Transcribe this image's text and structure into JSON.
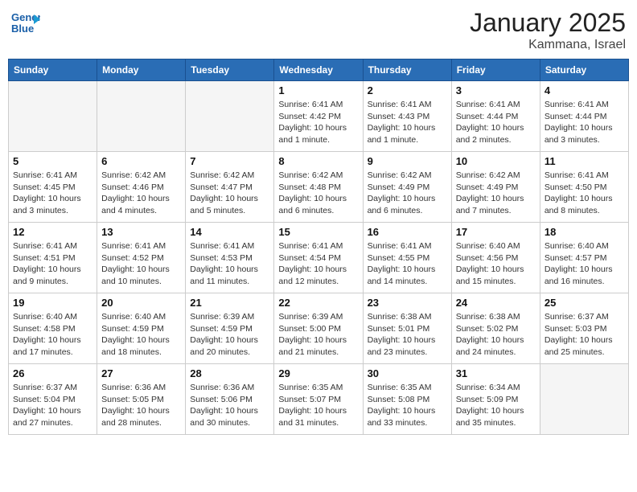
{
  "header": {
    "logo_text_general": "General",
    "logo_text_blue": "Blue",
    "title": "January 2025",
    "subtitle": "Kammana, Israel"
  },
  "calendar": {
    "days_of_week": [
      "Sunday",
      "Monday",
      "Tuesday",
      "Wednesday",
      "Thursday",
      "Friday",
      "Saturday"
    ],
    "weeks": [
      [
        {
          "day": "",
          "info": ""
        },
        {
          "day": "",
          "info": ""
        },
        {
          "day": "",
          "info": ""
        },
        {
          "day": "1",
          "info": "Sunrise: 6:41 AM\nSunset: 4:42 PM\nDaylight: 10 hours\nand 1 minute."
        },
        {
          "day": "2",
          "info": "Sunrise: 6:41 AM\nSunset: 4:43 PM\nDaylight: 10 hours\nand 1 minute."
        },
        {
          "day": "3",
          "info": "Sunrise: 6:41 AM\nSunset: 4:44 PM\nDaylight: 10 hours\nand 2 minutes."
        },
        {
          "day": "4",
          "info": "Sunrise: 6:41 AM\nSunset: 4:44 PM\nDaylight: 10 hours\nand 3 minutes."
        }
      ],
      [
        {
          "day": "5",
          "info": "Sunrise: 6:41 AM\nSunset: 4:45 PM\nDaylight: 10 hours\nand 3 minutes."
        },
        {
          "day": "6",
          "info": "Sunrise: 6:42 AM\nSunset: 4:46 PM\nDaylight: 10 hours\nand 4 minutes."
        },
        {
          "day": "7",
          "info": "Sunrise: 6:42 AM\nSunset: 4:47 PM\nDaylight: 10 hours\nand 5 minutes."
        },
        {
          "day": "8",
          "info": "Sunrise: 6:42 AM\nSunset: 4:48 PM\nDaylight: 10 hours\nand 6 minutes."
        },
        {
          "day": "9",
          "info": "Sunrise: 6:42 AM\nSunset: 4:49 PM\nDaylight: 10 hours\nand 6 minutes."
        },
        {
          "day": "10",
          "info": "Sunrise: 6:42 AM\nSunset: 4:49 PM\nDaylight: 10 hours\nand 7 minutes."
        },
        {
          "day": "11",
          "info": "Sunrise: 6:41 AM\nSunset: 4:50 PM\nDaylight: 10 hours\nand 8 minutes."
        }
      ],
      [
        {
          "day": "12",
          "info": "Sunrise: 6:41 AM\nSunset: 4:51 PM\nDaylight: 10 hours\nand 9 minutes."
        },
        {
          "day": "13",
          "info": "Sunrise: 6:41 AM\nSunset: 4:52 PM\nDaylight: 10 hours\nand 10 minutes."
        },
        {
          "day": "14",
          "info": "Sunrise: 6:41 AM\nSunset: 4:53 PM\nDaylight: 10 hours\nand 11 minutes."
        },
        {
          "day": "15",
          "info": "Sunrise: 6:41 AM\nSunset: 4:54 PM\nDaylight: 10 hours\nand 12 minutes."
        },
        {
          "day": "16",
          "info": "Sunrise: 6:41 AM\nSunset: 4:55 PM\nDaylight: 10 hours\nand 14 minutes."
        },
        {
          "day": "17",
          "info": "Sunrise: 6:40 AM\nSunset: 4:56 PM\nDaylight: 10 hours\nand 15 minutes."
        },
        {
          "day": "18",
          "info": "Sunrise: 6:40 AM\nSunset: 4:57 PM\nDaylight: 10 hours\nand 16 minutes."
        }
      ],
      [
        {
          "day": "19",
          "info": "Sunrise: 6:40 AM\nSunset: 4:58 PM\nDaylight: 10 hours\nand 17 minutes."
        },
        {
          "day": "20",
          "info": "Sunrise: 6:40 AM\nSunset: 4:59 PM\nDaylight: 10 hours\nand 18 minutes."
        },
        {
          "day": "21",
          "info": "Sunrise: 6:39 AM\nSunset: 4:59 PM\nDaylight: 10 hours\nand 20 minutes."
        },
        {
          "day": "22",
          "info": "Sunrise: 6:39 AM\nSunset: 5:00 PM\nDaylight: 10 hours\nand 21 minutes."
        },
        {
          "day": "23",
          "info": "Sunrise: 6:38 AM\nSunset: 5:01 PM\nDaylight: 10 hours\nand 23 minutes."
        },
        {
          "day": "24",
          "info": "Sunrise: 6:38 AM\nSunset: 5:02 PM\nDaylight: 10 hours\nand 24 minutes."
        },
        {
          "day": "25",
          "info": "Sunrise: 6:37 AM\nSunset: 5:03 PM\nDaylight: 10 hours\nand 25 minutes."
        }
      ],
      [
        {
          "day": "26",
          "info": "Sunrise: 6:37 AM\nSunset: 5:04 PM\nDaylight: 10 hours\nand 27 minutes."
        },
        {
          "day": "27",
          "info": "Sunrise: 6:36 AM\nSunset: 5:05 PM\nDaylight: 10 hours\nand 28 minutes."
        },
        {
          "day": "28",
          "info": "Sunrise: 6:36 AM\nSunset: 5:06 PM\nDaylight: 10 hours\nand 30 minutes."
        },
        {
          "day": "29",
          "info": "Sunrise: 6:35 AM\nSunset: 5:07 PM\nDaylight: 10 hours\nand 31 minutes."
        },
        {
          "day": "30",
          "info": "Sunrise: 6:35 AM\nSunset: 5:08 PM\nDaylight: 10 hours\nand 33 minutes."
        },
        {
          "day": "31",
          "info": "Sunrise: 6:34 AM\nSunset: 5:09 PM\nDaylight: 10 hours\nand 35 minutes."
        },
        {
          "day": "",
          "info": ""
        }
      ]
    ]
  }
}
